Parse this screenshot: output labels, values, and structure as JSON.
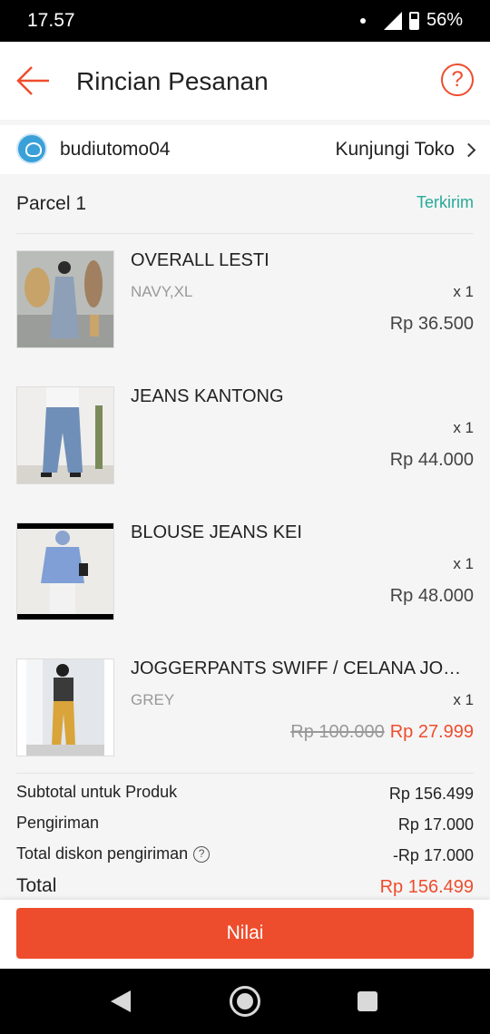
{
  "status_bar": {
    "time": "17.57",
    "battery": "56%"
  },
  "header": {
    "title": "Rincian Pesanan"
  },
  "shop": {
    "name": "budiutomo04",
    "visit_label": "Kunjungi Toko"
  },
  "parcel": {
    "label": "Parcel 1",
    "status": "Terkirim",
    "items": [
      {
        "name": "OVERALL LESTI",
        "variant": "NAVY,XL",
        "qty": "x 1",
        "price": "Rp 36.500",
        "original_price": ""
      },
      {
        "name": "JEANS KANTONG",
        "variant": "",
        "qty": "x 1",
        "price": "Rp 44.000",
        "original_price": ""
      },
      {
        "name": "BLOUSE JEANS KEI",
        "variant": "",
        "qty": "x 1",
        "price": "Rp 48.000",
        "original_price": ""
      },
      {
        "name": "JOGGERPANTS SWIFF / CELANA JOGGER",
        "variant": "GREY",
        "qty": "x 1",
        "price": "Rp 27.999",
        "original_price": "Rp 100.000"
      }
    ]
  },
  "summary": {
    "subtotal_label": "Subtotal untuk Produk",
    "subtotal_value": "Rp 156.499",
    "shipping_label": "Pengiriman",
    "shipping_value": "Rp 17.000",
    "ship_discount_label": "Total diskon pengiriman",
    "ship_discount_value": "-Rp 17.000",
    "total_label": "Total",
    "total_value": "Rp 156.499"
  },
  "actions": {
    "rate_label": "Nilai"
  },
  "colors": {
    "accent": "#ee4d2d",
    "status_green": "#26aa99"
  }
}
